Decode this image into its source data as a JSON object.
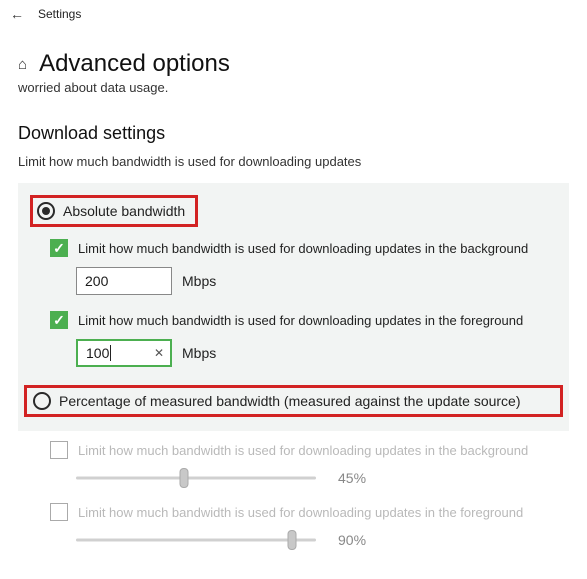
{
  "top": {
    "settings_label": "Settings"
  },
  "page": {
    "title": "Advanced options",
    "desc_fragment": "worried about data usage."
  },
  "download": {
    "section_title": "Download settings",
    "section_sub": "Limit how much bandwidth is used for downloading updates",
    "absolute": {
      "label": "Absolute bandwidth",
      "bg_check_label": "Limit how much bandwidth is used for downloading updates in the background",
      "bg_value": "200",
      "bg_unit": "Mbps",
      "fg_check_label": "Limit how much bandwidth is used for downloading updates in the foreground",
      "fg_value": "100",
      "fg_unit": "Mbps"
    },
    "percentage": {
      "label": "Percentage of measured bandwidth (measured against the update source)",
      "bg_check_label": "Limit how much bandwidth is used for downloading updates in the background",
      "bg_pct": "45%",
      "bg_pct_pos": 45,
      "fg_check_label": "Limit how much bandwidth is used for downloading updates in the foreground",
      "fg_pct": "90%",
      "fg_pct_pos": 90
    }
  }
}
